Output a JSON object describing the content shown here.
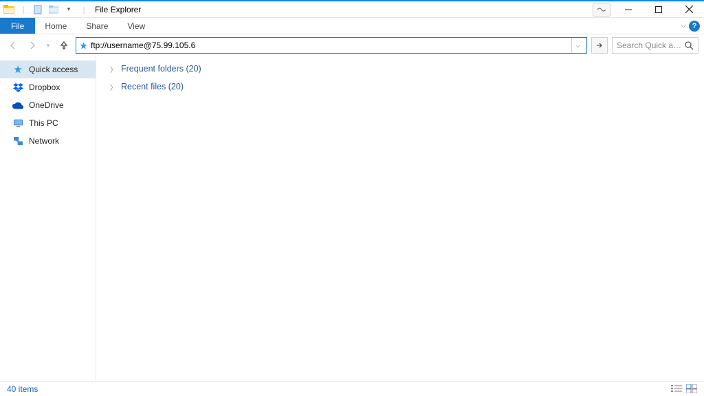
{
  "title": "File Explorer",
  "ribbon": {
    "file": "File",
    "tabs": [
      "Home",
      "Share",
      "View"
    ]
  },
  "nav": {
    "address": "ftp://username@75.99.105.6",
    "search_placeholder": "Search Quick acc..."
  },
  "sidebar": {
    "items": [
      {
        "label": "Quick access",
        "icon": "star",
        "selected": true
      },
      {
        "label": "Dropbox",
        "icon": "dropbox",
        "selected": false
      },
      {
        "label": "OneDrive",
        "icon": "onedrive",
        "selected": false
      },
      {
        "label": "This PC",
        "icon": "pc",
        "selected": false
      },
      {
        "label": "Network",
        "icon": "network",
        "selected": false
      }
    ]
  },
  "content": {
    "groups": [
      {
        "label": "Frequent folders (20)"
      },
      {
        "label": "Recent files (20)"
      }
    ]
  },
  "status": {
    "text": "40 items"
  }
}
